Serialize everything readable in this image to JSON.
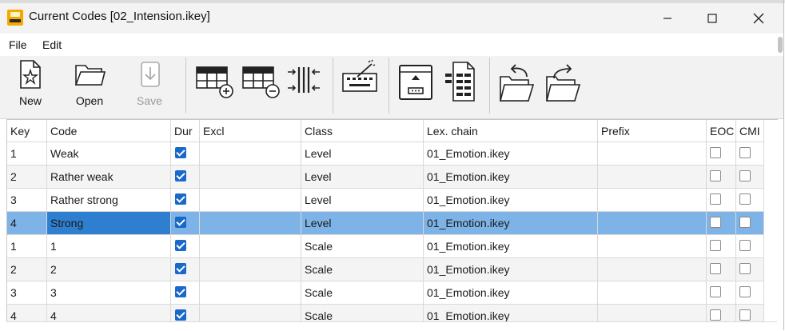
{
  "window": {
    "title": "Current Codes [02_Intension.ikey]"
  },
  "menu": [
    "File",
    "Edit"
  ],
  "toolbar": {
    "new_label": "New",
    "open_label": "Open",
    "save_label": "Save"
  },
  "grid": {
    "columns": [
      "Key",
      "Code",
      "Dur",
      "Excl",
      "Class",
      "Lex. chain",
      "Prefix",
      "EOC",
      "CMI"
    ],
    "rows": [
      {
        "key": "1",
        "code": "Weak",
        "dur": true,
        "excl": "",
        "class": "Level",
        "lex": "01_Emotion.ikey",
        "prefix": "",
        "eoc": false,
        "cmi": false
      },
      {
        "key": "2",
        "code": "Rather weak",
        "dur": true,
        "excl": "",
        "class": "Level",
        "lex": "01_Emotion.ikey",
        "prefix": "",
        "eoc": false,
        "cmi": false
      },
      {
        "key": "3",
        "code": "Rather strong",
        "dur": true,
        "excl": "",
        "class": "Level",
        "lex": "01_Emotion.ikey",
        "prefix": "",
        "eoc": false,
        "cmi": false
      },
      {
        "key": "4",
        "code": "Strong",
        "dur": true,
        "excl": "",
        "class": "Level",
        "lex": "01_Emotion.ikey",
        "prefix": "",
        "eoc": false,
        "cmi": false,
        "selected": true
      },
      {
        "key": "1",
        "code": "1",
        "dur": true,
        "excl": "",
        "class": "Scale",
        "lex": "01_Emotion.ikey",
        "prefix": "",
        "eoc": false,
        "cmi": false
      },
      {
        "key": "2",
        "code": "2",
        "dur": true,
        "excl": "",
        "class": "Scale",
        "lex": "01_Emotion.ikey",
        "prefix": "",
        "eoc": false,
        "cmi": false
      },
      {
        "key": "3",
        "code": "3",
        "dur": true,
        "excl": "",
        "class": "Scale",
        "lex": "01_Emotion.ikey",
        "prefix": "",
        "eoc": false,
        "cmi": false
      },
      {
        "key": "4",
        "code": "4",
        "dur": true,
        "excl": "",
        "class": "Scale",
        "lex": "01_Emotion.ikey",
        "prefix": "",
        "eoc": false,
        "cmi": false
      }
    ]
  },
  "colors": {
    "selected_row": "#7db3e6",
    "selected_cell": "#2f7fd1",
    "checkbox_on": "#1869c9"
  }
}
